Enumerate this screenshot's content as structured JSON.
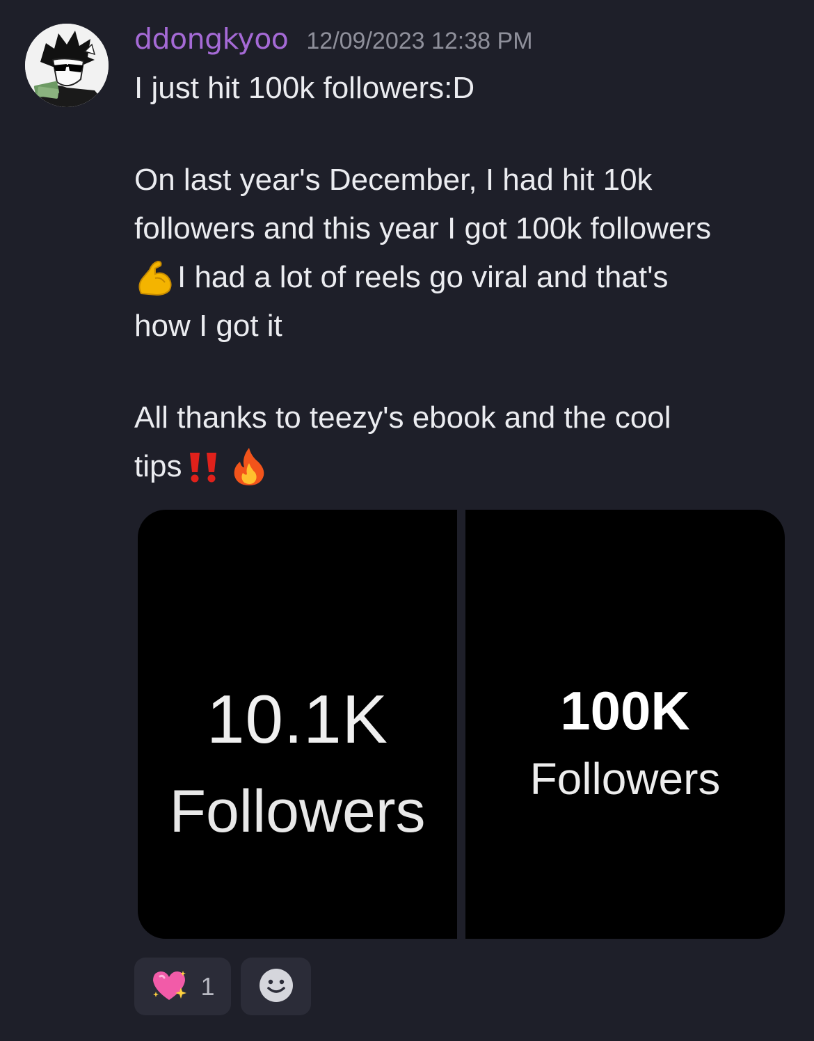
{
  "message": {
    "username": "ddongkyoo",
    "timestamp": "12/09/2023 12:38 PM",
    "lines": {
      "l1": "I just hit 100k followers:D",
      "l2": "On last year's December, I had hit 10k",
      "l3": "followers and this year I got 100k followers",
      "l4": "I had a lot of reels go viral and that's",
      "l5": "how I got it",
      "l6": "All thanks to teezy's ebook and the cool",
      "l7": "tips"
    },
    "emojis": {
      "flexed_biceps": "muscle-emoji",
      "double_exclamation": "double-exclamation-emoji",
      "fire": "fire-emoji"
    },
    "attachments": [
      {
        "count": "10.1K",
        "label": "Followers"
      },
      {
        "count": "100K",
        "label": "Followers"
      }
    ],
    "reactions": [
      {
        "emoji": "sparkling-heart-emoji",
        "count": "1"
      }
    ],
    "add_reaction_icon": "smiley-add-reaction-icon"
  },
  "colors": {
    "background": "#1e1f29",
    "username": "#a56ad6",
    "timestamp": "#8f909b",
    "text": "#ebecf0",
    "reaction_bg": "#2b2c38"
  }
}
